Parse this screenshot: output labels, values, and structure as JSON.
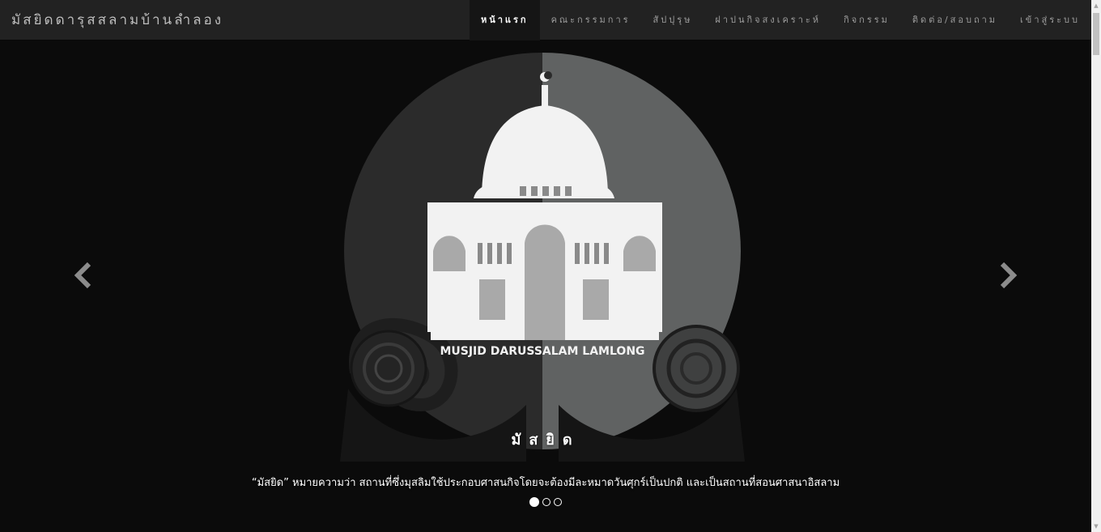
{
  "site": {
    "brand": "มัสยิดดารุสสลามบ้านลำลอง"
  },
  "nav": {
    "items": [
      {
        "label": "หน้าแรก"
      },
      {
        "label": "คณะกรรมการ"
      },
      {
        "label": "สัปปุรุษ"
      },
      {
        "label": "ฝาปนกิจสงเคราะห์"
      },
      {
        "label": "กิจกรรม"
      },
      {
        "label": "ติดต่อ/สอบถาม"
      },
      {
        "label": "เข้าสู่ระบบ"
      }
    ],
    "active_index": 0
  },
  "carousel": {
    "logo_text": "MUSJID DARUSSALAM LAMLONG",
    "caption_title": "มัสยิด",
    "caption_text": "“มัสยิด” หมายความว่า สถานที่ซึ่งมุสลิมใช้ประกอบศาสนกิจโดยจะต้องมีละหมาดวันศุกร์เป็นปกติ และเป็นสถานที่สอนศาสนาอิสลาม",
    "slide_count": 3,
    "active_slide": 1,
    "prev_icon": "chevron-left-icon",
    "next_icon": "chevron-right-icon"
  },
  "colors": {
    "navbar": "#222222",
    "background": "#0b0b0b",
    "logo_left": "#2b2b2b",
    "logo_right": "#606262",
    "mosque": "#f2f2f2"
  }
}
